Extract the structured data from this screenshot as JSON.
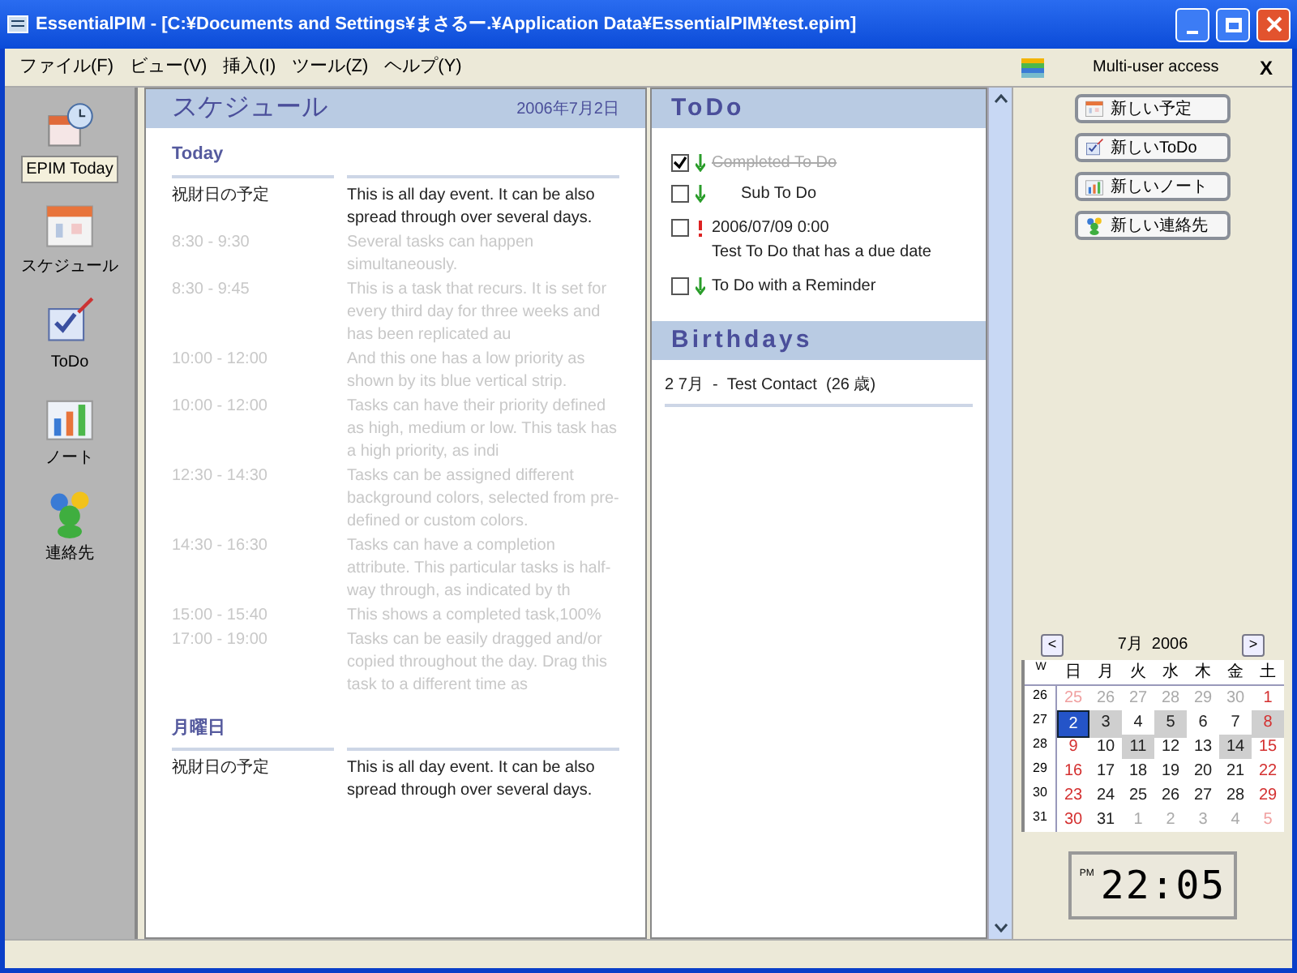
{
  "window": {
    "title": "EssentialPIM - [C:¥Documents and Settings¥まさるー.¥Application Data¥EssentialPIM¥test.epim]"
  },
  "menu": [
    "ファイル(F)",
    "ビュー(V)",
    "挿入(I)",
    "ツール(Z)",
    "ヘルプ(Y)"
  ],
  "multi_user": {
    "label": "Multi-user access",
    "close": "X"
  },
  "sidebar": {
    "items": [
      {
        "label": "EPIM Today",
        "kind": "today",
        "selected": true
      },
      {
        "label": "スケジュール",
        "kind": "schedule",
        "selected": false
      },
      {
        "label": "ToDo",
        "kind": "todo",
        "selected": false
      },
      {
        "label": "ノート",
        "kind": "notes",
        "selected": false
      },
      {
        "label": "連絡先",
        "kind": "contacts",
        "selected": false
      }
    ]
  },
  "schedule": {
    "title": "スケジュール",
    "date": "2006年7月2日",
    "days": [
      {
        "heading": "Today",
        "entries": [
          {
            "time": "祝財日の予定",
            "text": "This is all day event. It can be also spread through over several days.",
            "kind": "allday"
          },
          {
            "time": "8:30 - 9:30",
            "text": "Several tasks can happen simultaneously.",
            "kind": "task"
          },
          {
            "time": "8:30 - 9:45",
            "text": "This is a task that recurs. It is set for every third day for three weeks and has been replicated au",
            "kind": "task"
          },
          {
            "time": "10:00 - 12:00",
            "text": "And this one has a low priority as shown by its blue vertical strip.",
            "kind": "task"
          },
          {
            "time": "10:00 - 12:00",
            "text": "Tasks can have their priority defined as high, medium or low. This task has a high priority, as indi",
            "kind": "task"
          },
          {
            "time": "12:30 - 14:30",
            "text": "Tasks can be assigned different background colors, selected from pre-defined or custom colors.",
            "kind": "task"
          },
          {
            "time": "14:30 - 16:30",
            "text": "Tasks can have a completion attribute. This particular tasks is half-way through, as indicated by th",
            "kind": "task"
          },
          {
            "time": "15:00 - 15:40",
            "text": "This shows a completed task,100%",
            "kind": "task"
          },
          {
            "time": "17:00 - 19:00",
            "text": "Tasks can be easily dragged and/or copied throughout the day. Drag this task to a different time as",
            "kind": "task"
          }
        ]
      },
      {
        "heading": "月曜日",
        "entries": [
          {
            "time": "祝財日の予定",
            "text": "This is all day event. It can be also spread through over several days.",
            "kind": "allday"
          }
        ]
      }
    ]
  },
  "todo": {
    "title": "ToDo",
    "items": [
      {
        "text": "Completed To Do",
        "checked": true,
        "high_priority": false,
        "children": [
          {
            "text": "Sub To Do",
            "checked": false,
            "high_priority": false
          }
        ]
      },
      {
        "due": "2006/07/09 0:00",
        "text": "Test To Do that has a due date",
        "checked": false,
        "high_priority": true
      },
      {
        "text": "To Do with a Reminder",
        "checked": false,
        "high_priority": false
      }
    ]
  },
  "birthdays": {
    "title": "Birthdays",
    "items": [
      "2 7月  -  Test Contact  (26 歳)"
    ]
  },
  "actions": [
    {
      "label": "新しい予定",
      "kind": "schedule"
    },
    {
      "label": "新しいToDo",
      "kind": "todo"
    },
    {
      "label": "新しいノート",
      "kind": "notes"
    },
    {
      "label": "新しい連絡先",
      "kind": "contacts"
    }
  ],
  "calendar": {
    "month": "7月  2006",
    "prev": "<",
    "next": ">",
    "week_header": "W",
    "weekdays": [
      "日",
      "月",
      "火",
      "水",
      "木",
      "金",
      "土"
    ],
    "weeks": [
      {
        "week": "26",
        "days": [
          {
            "d": "25",
            "outside": true,
            "holiday": true,
            "busy": false,
            "selected": false
          },
          {
            "d": "26",
            "outside": true,
            "holiday": false,
            "busy": false,
            "selected": false
          },
          {
            "d": "27",
            "outside": true,
            "holiday": false,
            "busy": false,
            "selected": false
          },
          {
            "d": "28",
            "outside": true,
            "holiday": false,
            "busy": false,
            "selected": false
          },
          {
            "d": "29",
            "outside": true,
            "holiday": false,
            "busy": false,
            "selected": false
          },
          {
            "d": "30",
            "outside": true,
            "holiday": false,
            "busy": false,
            "selected": false
          },
          {
            "d": "1",
            "outside": false,
            "holiday": true,
            "busy": false,
            "selected": false
          }
        ]
      },
      {
        "week": "27",
        "days": [
          {
            "d": "2",
            "outside": false,
            "holiday": true,
            "busy": false,
            "selected": true
          },
          {
            "d": "3",
            "outside": false,
            "holiday": false,
            "busy": true,
            "selected": false
          },
          {
            "d": "4",
            "outside": false,
            "holiday": false,
            "busy": false,
            "selected": false
          },
          {
            "d": "5",
            "outside": false,
            "holiday": false,
            "busy": true,
            "selected": false
          },
          {
            "d": "6",
            "outside": false,
            "holiday": false,
            "busy": false,
            "selected": false
          },
          {
            "d": "7",
            "outside": false,
            "holiday": false,
            "busy": false,
            "selected": false
          },
          {
            "d": "8",
            "outside": false,
            "holiday": true,
            "busy": true,
            "selected": false
          }
        ]
      },
      {
        "week": "28",
        "days": [
          {
            "d": "9",
            "outside": false,
            "holiday": true,
            "busy": false,
            "selected": false
          },
          {
            "d": "10",
            "outside": false,
            "holiday": false,
            "busy": false,
            "selected": false
          },
          {
            "d": "11",
            "outside": false,
            "holiday": false,
            "busy": true,
            "selected": false
          },
          {
            "d": "12",
            "outside": false,
            "holiday": false,
            "busy": false,
            "selected": false
          },
          {
            "d": "13",
            "outside": false,
            "holiday": false,
            "busy": false,
            "selected": false
          },
          {
            "d": "14",
            "outside": false,
            "holiday": false,
            "busy": true,
            "selected": false
          },
          {
            "d": "15",
            "outside": false,
            "holiday": true,
            "busy": false,
            "selected": false
          }
        ]
      },
      {
        "week": "29",
        "days": [
          {
            "d": "16",
            "outside": false,
            "holiday": true,
            "busy": false,
            "selected": false
          },
          {
            "d": "17",
            "outside": false,
            "holiday": false,
            "busy": false,
            "selected": false
          },
          {
            "d": "18",
            "outside": false,
            "holiday": false,
            "busy": false,
            "selected": false
          },
          {
            "d": "19",
            "outside": false,
            "holiday": false,
            "busy": false,
            "selected": false
          },
          {
            "d": "20",
            "outside": false,
            "holiday": false,
            "busy": false,
            "selected": false
          },
          {
            "d": "21",
            "outside": false,
            "holiday": false,
            "busy": false,
            "selected": false
          },
          {
            "d": "22",
            "outside": false,
            "holiday": true,
            "busy": false,
            "selected": false
          }
        ]
      },
      {
        "week": "30",
        "days": [
          {
            "d": "23",
            "outside": false,
            "holiday": true,
            "busy": false,
            "selected": false
          },
          {
            "d": "24",
            "outside": false,
            "holiday": false,
            "busy": false,
            "selected": false
          },
          {
            "d": "25",
            "outside": false,
            "holiday": false,
            "busy": false,
            "selected": false
          },
          {
            "d": "26",
            "outside": false,
            "holiday": false,
            "busy": false,
            "selected": false
          },
          {
            "d": "27",
            "outside": false,
            "holiday": false,
            "busy": false,
            "selected": false
          },
          {
            "d": "28",
            "outside": false,
            "holiday": false,
            "busy": false,
            "selected": false
          },
          {
            "d": "29",
            "outside": false,
            "holiday": true,
            "busy": false,
            "selected": false
          }
        ]
      },
      {
        "week": "31",
        "days": [
          {
            "d": "30",
            "outside": false,
            "holiday": true,
            "busy": false,
            "selected": false
          },
          {
            "d": "31",
            "outside": false,
            "holiday": false,
            "busy": false,
            "selected": false
          },
          {
            "d": "1",
            "outside": true,
            "holiday": false,
            "busy": false,
            "selected": false
          },
          {
            "d": "2",
            "outside": true,
            "holiday": false,
            "busy": false,
            "selected": false
          },
          {
            "d": "3",
            "outside": true,
            "holiday": false,
            "busy": false,
            "selected": false
          },
          {
            "d": "4",
            "outside": true,
            "holiday": false,
            "busy": false,
            "selected": false
          },
          {
            "d": "5",
            "outside": true,
            "holiday": true,
            "busy": false,
            "selected": false
          }
        ]
      }
    ]
  },
  "clock": {
    "period": "PM",
    "time": "22:05"
  }
}
